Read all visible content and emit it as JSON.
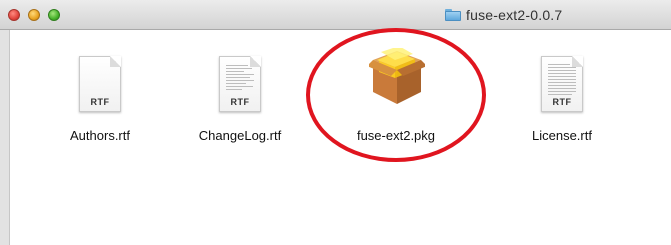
{
  "window": {
    "title": "fuse-ext2-0.0.7",
    "title_icon": "folder-icon"
  },
  "files": [
    {
      "name": "Authors.rtf",
      "kind": "document",
      "badge": "RTF"
    },
    {
      "name": "ChangeLog.rtf",
      "kind": "document",
      "badge": "RTF"
    },
    {
      "name": "fuse-ext2.pkg",
      "kind": "package-icon",
      "highlighted": true
    },
    {
      "name": "License.rtf",
      "kind": "document",
      "badge": "RTF"
    }
  ],
  "colors": {
    "highlight_ring": "#e0151f"
  }
}
